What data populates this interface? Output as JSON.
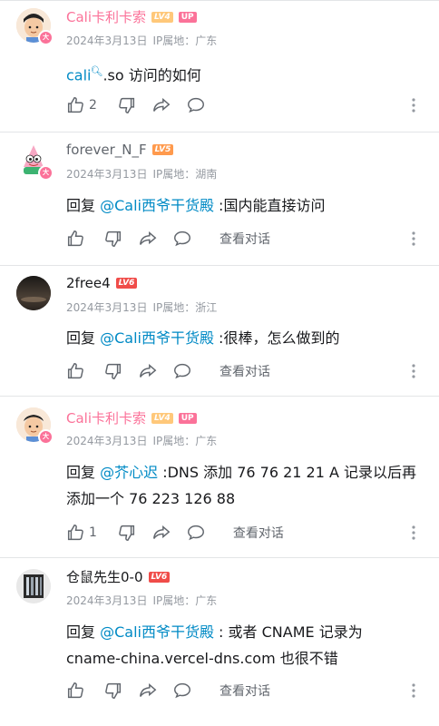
{
  "comments": [
    {
      "username": "Cali卡利卡索",
      "level": "LV4",
      "level_color": "#ffc87a",
      "up": "UP",
      "date": "2024年3月13日",
      "ip": "IP属地：广东",
      "text_pre": "",
      "mention": "cali",
      "text": ".so 访问的如何",
      "likes": "2",
      "view_conv": ""
    },
    {
      "username": "forever_N_F",
      "level": "LV5",
      "level_color": "#ff9a4d",
      "up": "",
      "date": "2024年3月13日",
      "ip": "IP属地：湖南",
      "text_pre": "回复 ",
      "mention": "@Cali西爷干货殿",
      "text": " :国内能直接访问",
      "likes": "",
      "view_conv": "查看对话"
    },
    {
      "username": "2free4",
      "level": "LV6",
      "level_color": "#f04c49",
      "up": "",
      "date": "2024年3月13日",
      "ip": "IP属地：浙江",
      "text_pre": "回复 ",
      "mention": "@Cali西爷干货殿",
      "text": " :很棒，怎么做到的",
      "likes": "",
      "view_conv": "查看对话"
    },
    {
      "username": "Cali卡利卡索",
      "level": "LV4",
      "level_color": "#ffc87a",
      "up": "UP",
      "date": "2024年3月13日",
      "ip": "IP属地：广东",
      "text_pre": "回复 ",
      "mention": "@芥心迟",
      "text": " :DNS 添加 76 76 21 21 A 记录以后再添加一个 76 223 126 88",
      "likes": "1",
      "view_conv": "查看对话"
    },
    {
      "username": "仓鼠先生0-0",
      "level": "LV6",
      "level_color": "#f04c49",
      "up": "",
      "date": "2024年3月13日",
      "ip": "IP属地：广东",
      "text_pre": "回复 ",
      "mention": "@Cali西爷干货殿",
      "text": " : 或者 CNAME 记录为 cname-china.vercel-dns.com 也很不错",
      "likes": "",
      "view_conv": "查看对话"
    }
  ],
  "colors": {
    "accent_pink": "#fb7299",
    "link_blue": "#008ac5",
    "meta_gray": "#9499a0"
  }
}
